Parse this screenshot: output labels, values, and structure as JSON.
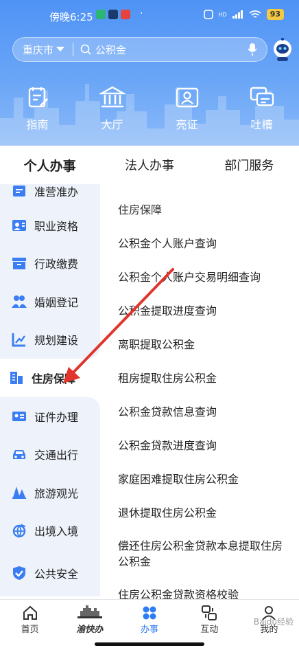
{
  "status": {
    "time": "傍晚6:25",
    "battery": "93",
    "signal": "HD"
  },
  "search": {
    "city": "重庆市",
    "query": "公积金"
  },
  "quick": [
    {
      "label": "指南",
      "icon": "guide-icon"
    },
    {
      "label": "大厅",
      "icon": "hall-icon"
    },
    {
      "label": "亮证",
      "icon": "id-card-icon"
    },
    {
      "label": "吐槽",
      "icon": "feedback-icon"
    }
  ],
  "tabs": [
    {
      "label": "个人办事",
      "active": true
    },
    {
      "label": "法人办事",
      "active": false
    },
    {
      "label": "部门服务",
      "active": false
    }
  ],
  "sidebar": [
    {
      "label": "准营准办"
    },
    {
      "label": "职业资格"
    },
    {
      "label": "行政缴费"
    },
    {
      "label": "婚姻登记"
    },
    {
      "label": "规划建设"
    },
    {
      "label": "住房保障"
    },
    {
      "label": "证件办理"
    },
    {
      "label": "交通出行"
    },
    {
      "label": "旅游观光"
    },
    {
      "label": "出境入境"
    },
    {
      "label": "公共安全"
    }
  ],
  "content": {
    "section_title": "住房保障",
    "items": [
      "公积金个人账户查询",
      "公积金个人账户交易明细查询",
      "公积金提取进度查询",
      "离职提取公积金",
      "租房提取住房公积金",
      "公积金贷款信息查询",
      "公积金贷款进度查询",
      "家庭困难提取住房公积金",
      "退休提取住房公积金",
      "偿还住房公积金贷款本息提取住房公积金",
      "住房公积金贷款资格校验"
    ]
  },
  "bottom_nav": [
    {
      "label": "首页"
    },
    {
      "label": "渝快办"
    },
    {
      "label": "办事"
    },
    {
      "label": "互动"
    },
    {
      "label": "我的"
    }
  ],
  "colors": {
    "accent": "#2f7cf6",
    "header_gradient_top": "#4f93f6",
    "sidebar_bg": "#eef3fb",
    "arrow": "#e0342c"
  },
  "watermark": "Baidu经验"
}
